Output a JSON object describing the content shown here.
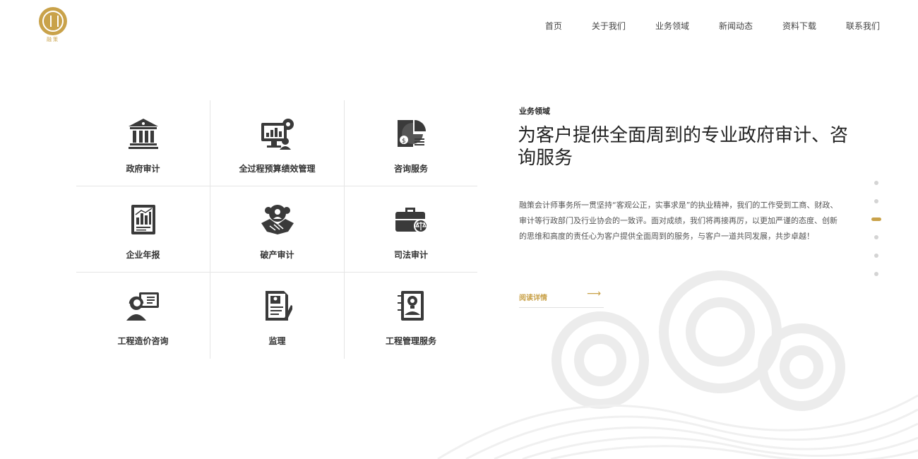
{
  "logo": {
    "text": "融策"
  },
  "nav": [
    "首页",
    "关于我们",
    "业务领域",
    "新闻动态",
    "资料下载",
    "联系我们"
  ],
  "services": [
    {
      "label": "政府审计",
      "icon": "bank-icon"
    },
    {
      "label": "全过程预算绩效管理",
      "icon": "monitor-chart-gear-icon"
    },
    {
      "label": "咨询服务",
      "icon": "report-pie-icon"
    },
    {
      "label": "企业年报",
      "icon": "annual-report-icon"
    },
    {
      "label": "破产审计",
      "icon": "handshake-people-icon"
    },
    {
      "label": "司法审计",
      "icon": "briefcase-scale-icon"
    },
    {
      "label": "工程造价咨询",
      "icon": "consultant-headset-icon"
    },
    {
      "label": "监理",
      "icon": "document-pen-icon"
    },
    {
      "label": "工程管理服务",
      "icon": "book-lightbulb-icon"
    }
  ],
  "about": {
    "section_label": "业务领域",
    "headline": "为客户提供全面周到的专业政府审计、咨询服务",
    "description": "融策会计师事务所一贯坚持“客观公正，实事求是”的执业精神，我们的工作受到工商、财政、审计等行政部门及行业协会的一致评。面对成绩，我们将再接再厉，以更加严谨的态度、创新的思维和高度的责任心为客户提供全面周到的服务，与客户一道共同发展，共步卓越！",
    "more_label": "阅读详情",
    "arrow": "⟶"
  },
  "pager": {
    "count": 6,
    "active_index": 2
  },
  "colors": {
    "accent": "#c9a24a",
    "text": "#333333",
    "divider": "#e5e5e5"
  }
}
